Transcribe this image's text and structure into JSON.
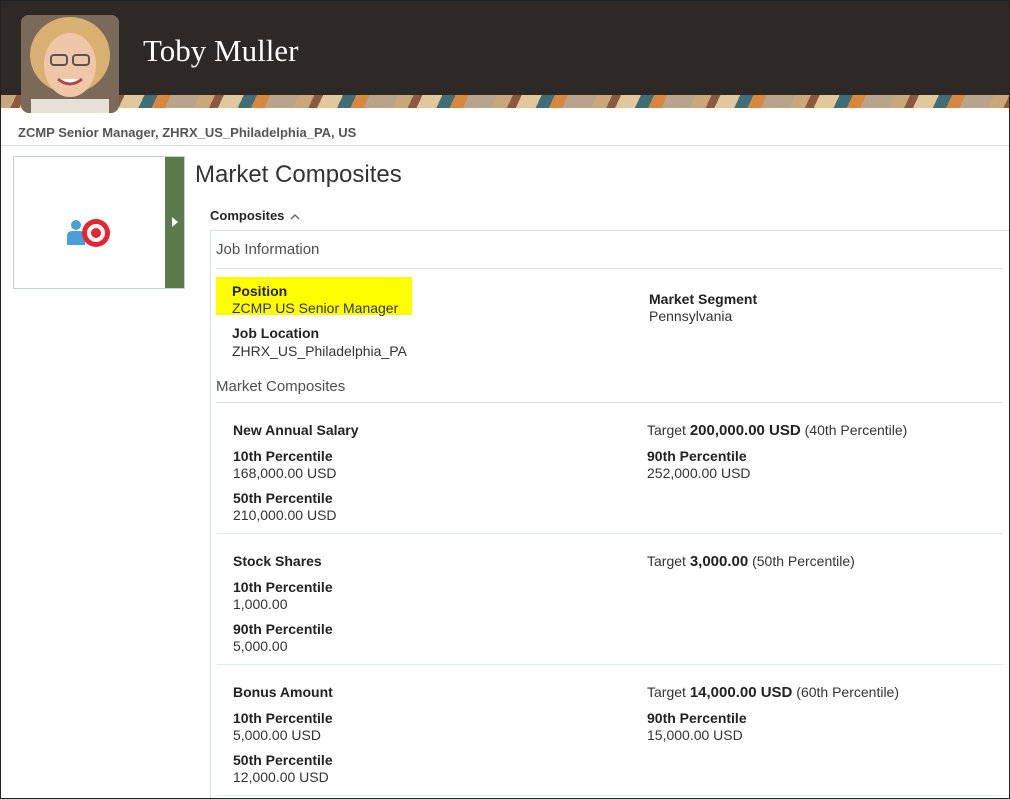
{
  "header": {
    "name": "Toby Muller"
  },
  "context_line": "ZCMP Senior Manager, ZHRX_US_Philadelphia_PA, US",
  "page_title": "Market Composites",
  "composites_label": "Composites",
  "job_info": {
    "section": "Job Information",
    "position_label": "Position",
    "position_value": "ZCMP US Senior Manager",
    "location_label": "Job Location",
    "location_value": "ZHRX_US_Philadelphia_PA",
    "segment_label": "Market Segment",
    "segment_value": "Pennsylvania"
  },
  "market": {
    "section": "Market Composites",
    "target_word": "Target",
    "rows": [
      {
        "name": "New Annual Salary",
        "target_amount": "200,000.00 USD",
        "target_pct": "(40th Percentile)",
        "left": [
          {
            "label": "10th Percentile",
            "value": "168,000.00 USD"
          },
          {
            "label": "50th Percentile",
            "value": "210,000.00 USD"
          }
        ],
        "right": [
          {
            "label": "90th Percentile",
            "value": "252,000.00 USD"
          }
        ]
      },
      {
        "name": "Stock Shares",
        "target_amount": "3,000.00",
        "target_pct": "(50th Percentile)",
        "left": [
          {
            "label": "10th Percentile",
            "value": "1,000.00"
          },
          {
            "label": "90th Percentile",
            "value": "5,000.00"
          }
        ],
        "right": []
      },
      {
        "name": "Bonus Amount",
        "target_amount": "14,000.00 USD",
        "target_pct": "(60th Percentile)",
        "left": [
          {
            "label": "10th Percentile",
            "value": "5,000.00 USD"
          },
          {
            "label": "50th Percentile",
            "value": "12,000.00 USD"
          }
        ],
        "right": [
          {
            "label": "90th Percentile",
            "value": "15,000.00 USD"
          }
        ]
      }
    ]
  },
  "colors": {
    "header_bg": "#2d2926",
    "tile_bar": "#5d7a4c",
    "highlight": "#ffff00",
    "icon_blue": "#4a9fd8",
    "icon_red": "#e3262f"
  },
  "icons": {
    "tile": "person-target-icon",
    "expand": "chevron-right-icon",
    "collapse": "chevron-up-icon"
  }
}
